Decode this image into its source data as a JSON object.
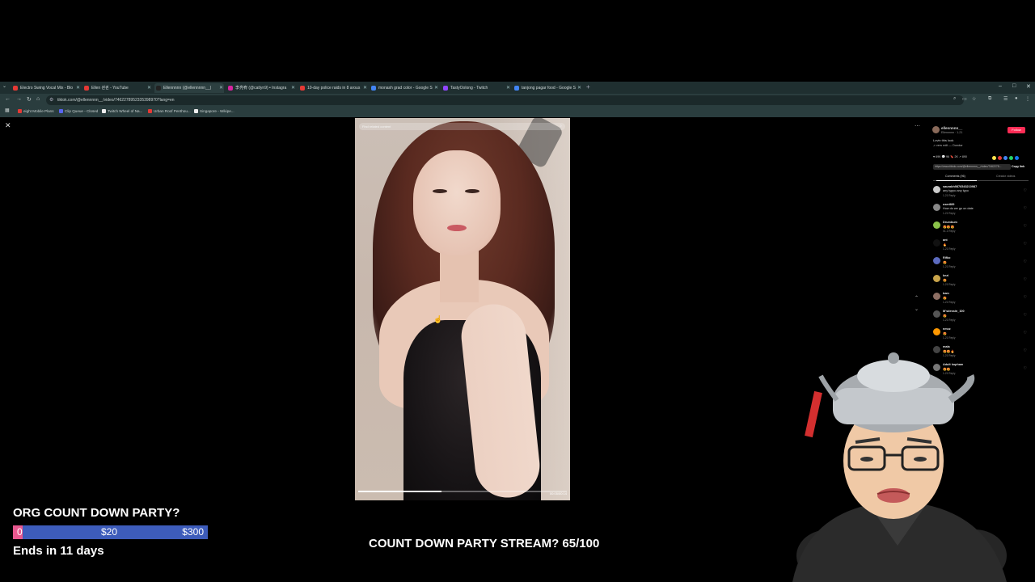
{
  "browser": {
    "tabs": [
      {
        "title": "Electro Swing Vocal Mix - Blo",
        "color": "#e53935"
      },
      {
        "title": "Ellen 퀸퀸 - YouTube",
        "color": "#e53935"
      },
      {
        "title": "Ellennnnn (@ellennnnn__)",
        "color": "#222222"
      },
      {
        "title": "李亮宥 (@catlyn9) • Instagra",
        "color": "#d6249f"
      },
      {
        "title": "10-day police raids in 8 arous",
        "color": "#e53935"
      },
      {
        "title": "monash grad color - Google S",
        "color": "#4285f4"
      },
      {
        "title": "TastyOolong - Twitch",
        "color": "#9146ff"
      },
      {
        "title": "tanjong pagar food - Google S",
        "color": "#4285f4"
      }
    ],
    "active_tab_index": 2,
    "url": "tiktok.com/@ellennnnn__/video/7462278952335398970?lang=en",
    "bookmarks": [
      {
        "label": "eight Mobile Plans",
        "color": "#e53935"
      },
      {
        "label": "Clip Queue - Closed",
        "color": "#5865f2"
      },
      {
        "label": "Twitch Wheel of Na...",
        "color": "#eeeeee"
      },
      {
        "label": "Urban Roof Penthou...",
        "color": "#e53935"
      },
      {
        "label": "Singapore - Wikipe...",
        "color": "#eeeeee"
      }
    ]
  },
  "video": {
    "search_placeholder": "Find related content",
    "progress": 0.4,
    "time": "00:05/00:14"
  },
  "panel": {
    "username": "ellennnnn__",
    "display": "Ellennnnn · 1-21",
    "follow_label": "Follow",
    "caption": "Lovin this look",
    "music": "♫ vers edit — Dundar",
    "stats": "♥ 69K   💬 96   🔖 2K   ↗ 890",
    "share_colors": [
      "#fce34d",
      "#e53935",
      "#4285f4",
      "#25d366",
      "#1877f2"
    ],
    "link": "https://www.tiktok.com/@ellennnnn__/video/7462278...",
    "copy_label": "Copy link",
    "tab_comments": "Comments (96)",
    "tab_creator": "Creator videos",
    "comments": [
      {
        "name": "saurabh9876543210987",
        "text": "any typpo any typo",
        "meta": "1-21   Reply",
        "color": "#cccccc"
      },
      {
        "name": "user889",
        "text": "How do we go on date",
        "meta": "1-21   Reply",
        "color": "#888888"
      },
      {
        "name": "Drumbum",
        "text": "😍😍😍",
        "meta": "01-1   Reply",
        "color": "#8bc34a"
      },
      {
        "name": "ant",
        "text": "🔥",
        "meta": "1-21   Reply",
        "color": "#111111"
      },
      {
        "name": "Rifko",
        "text": "😍",
        "meta": "1-21   Reply",
        "color": "#5c6bc0"
      },
      {
        "name": "kezi",
        "text": "😍",
        "meta": "1-21   Reply",
        "color": "#c9a44a"
      },
      {
        "name": "bam",
        "text": "😍",
        "meta": "1-21   Reply",
        "color": "#8d6e63"
      },
      {
        "name": "M'sdessin_100",
        "text": "😍",
        "meta": "1-21   Reply",
        "color": "#555555"
      },
      {
        "name": "nmcz",
        "text": "😍",
        "meta": "1-21   Reply",
        "color": "#ff9800"
      },
      {
        "name": "mala",
        "text": "😍😍🔥",
        "meta": "1-21   Reply",
        "color": "#444444"
      },
      {
        "name": "Adult kopham",
        "text": "😍😍",
        "meta": "1-21   Reply",
        "color": "#777777"
      }
    ]
  },
  "overlay": {
    "goal_title": "ORG COUNT DOWN PARTY?",
    "goal_current": "0",
    "goal_mid": "$20",
    "goal_max": "$300",
    "goal_progress": 0.05,
    "goal_ends": "Ends in 11 days",
    "poll_text": "COUNT DOWN PARTY STREAM? 65/100"
  },
  "colors": {
    "chrome_tabbar": "#1f2f30",
    "chrome_toolbar": "#2a3d3e",
    "goal_bar": "#3d5cbb",
    "goal_fill": "#e8588f",
    "follow_button": "#fe2c55"
  }
}
